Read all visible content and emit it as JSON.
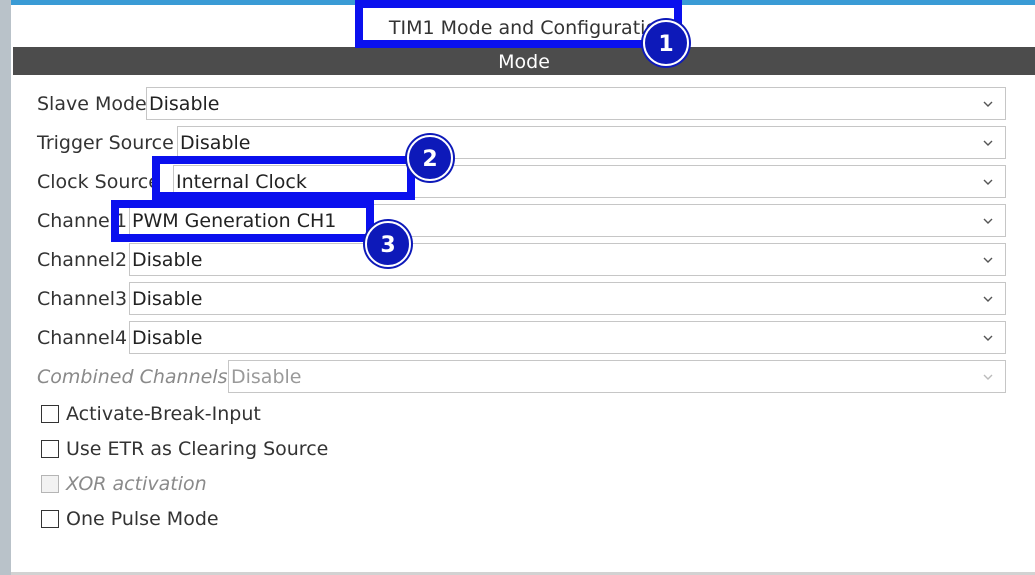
{
  "header": {
    "title": "TIM1 Mode and Configuratio",
    "section": "Mode"
  },
  "rows": [
    {
      "label": "Slave Mode",
      "value": "Disable",
      "disabled": false
    },
    {
      "label": "Trigger Source",
      "value": "Disable",
      "disabled": false
    },
    {
      "label": "Clock Source",
      "value": "Internal Clock",
      "disabled": false
    },
    {
      "label": "Channel1",
      "value": "PWM Generation CH1",
      "disabled": false
    },
    {
      "label": "Channel2",
      "value": "Disable",
      "disabled": false
    },
    {
      "label": "Channel3",
      "value": "Disable",
      "disabled": false
    },
    {
      "label": "Channel4",
      "value": "Disable",
      "disabled": false
    },
    {
      "label": "Combined Channels",
      "value": "Disable",
      "disabled": true
    }
  ],
  "checkboxes": [
    {
      "label": "Activate-Break-Input",
      "checked": false,
      "disabled": false
    },
    {
      "label": "Use ETR as Clearing Source",
      "checked": false,
      "disabled": false
    },
    {
      "label": "XOR activation",
      "checked": false,
      "disabled": true
    },
    {
      "label": "One Pulse Mode",
      "checked": false,
      "disabled": false
    }
  ],
  "annotations": [
    "1",
    "2",
    "3"
  ],
  "colors": {
    "highlight": "#0a10ee",
    "badge": "#0d19b9",
    "mode_bar": "#4c4c4c",
    "top_strip": "#3a9bd5"
  },
  "icons": {
    "dropdown": "chevron-down-icon"
  }
}
